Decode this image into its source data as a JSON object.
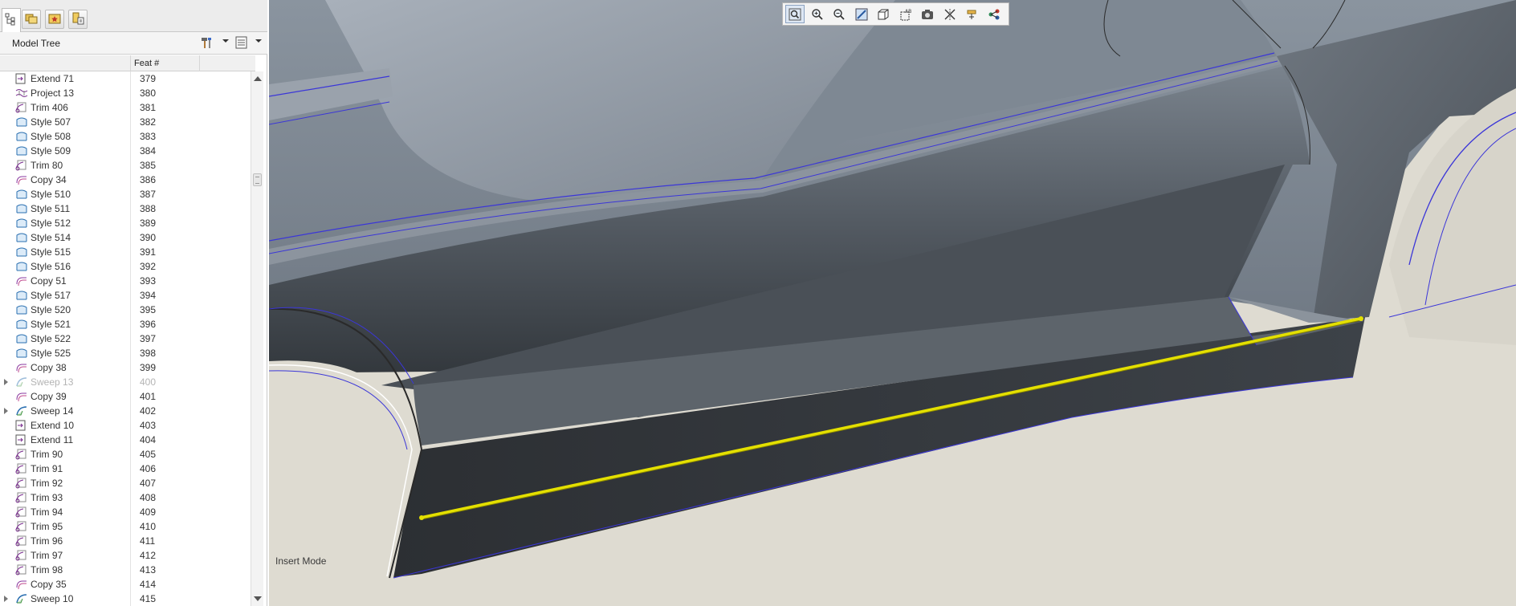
{
  "model_tree": {
    "title": "Model Tree",
    "column_feat": "Feat #",
    "rows": [
      {
        "name": "Extend 71",
        "num": "379",
        "icon": "extend-icon"
      },
      {
        "name": "Project 13",
        "num": "380",
        "icon": "project-icon"
      },
      {
        "name": "Trim 406",
        "num": "381",
        "icon": "trim-icon"
      },
      {
        "name": "Style 507",
        "num": "382",
        "icon": "style-icon"
      },
      {
        "name": "Style 508",
        "num": "383",
        "icon": "style-icon"
      },
      {
        "name": "Style 509",
        "num": "384",
        "icon": "style-icon"
      },
      {
        "name": "Trim 80",
        "num": "385",
        "icon": "trim-icon"
      },
      {
        "name": "Copy 34",
        "num": "386",
        "icon": "copy-icon"
      },
      {
        "name": "Style 510",
        "num": "387",
        "icon": "style-icon"
      },
      {
        "name": "Style 511",
        "num": "388",
        "icon": "style-icon"
      },
      {
        "name": "Style 512",
        "num": "389",
        "icon": "style-icon"
      },
      {
        "name": "Style 514",
        "num": "390",
        "icon": "style-icon"
      },
      {
        "name": "Style 515",
        "num": "391",
        "icon": "style-icon"
      },
      {
        "name": "Style 516",
        "num": "392",
        "icon": "style-icon"
      },
      {
        "name": "Copy 51",
        "num": "393",
        "icon": "copy-icon"
      },
      {
        "name": "Style 517",
        "num": "394",
        "icon": "style-icon"
      },
      {
        "name": "Style 520",
        "num": "395",
        "icon": "style-icon"
      },
      {
        "name": "Style 521",
        "num": "396",
        "icon": "style-icon"
      },
      {
        "name": "Style 522",
        "num": "397",
        "icon": "style-icon"
      },
      {
        "name": "Style 525",
        "num": "398",
        "icon": "style-icon"
      },
      {
        "name": "Copy 38",
        "num": "399",
        "icon": "copy-icon"
      },
      {
        "name": "Sweep 13",
        "num": "400",
        "icon": "sweep-icon",
        "expandable": true,
        "dim": true
      },
      {
        "name": "Copy 39",
        "num": "401",
        "icon": "copy-icon"
      },
      {
        "name": "Sweep 14",
        "num": "402",
        "icon": "sweep-icon",
        "expandable": true
      },
      {
        "name": "Extend 10",
        "num": "403",
        "icon": "extend-icon"
      },
      {
        "name": "Extend 11",
        "num": "404",
        "icon": "extend-icon"
      },
      {
        "name": "Trim 90",
        "num": "405",
        "icon": "trim-icon"
      },
      {
        "name": "Trim 91",
        "num": "406",
        "icon": "trim-icon"
      },
      {
        "name": "Trim 92",
        "num": "407",
        "icon": "trim-icon"
      },
      {
        "name": "Trim 93",
        "num": "408",
        "icon": "trim-icon"
      },
      {
        "name": "Trim 94",
        "num": "409",
        "icon": "trim-icon"
      },
      {
        "name": "Trim 95",
        "num": "410",
        "icon": "trim-icon"
      },
      {
        "name": "Trim 96",
        "num": "411",
        "icon": "trim-icon"
      },
      {
        "name": "Trim 97",
        "num": "412",
        "icon": "trim-icon"
      },
      {
        "name": "Trim 98",
        "num": "413",
        "icon": "trim-icon"
      },
      {
        "name": "Copy 35",
        "num": "414",
        "icon": "copy-icon"
      },
      {
        "name": "Sweep 10",
        "num": "415",
        "icon": "sweep-icon",
        "expandable": true
      }
    ]
  },
  "nav_tabs": [
    "model-tree-tab-icon",
    "folder-browser-tab-icon",
    "favorites-tab-icon",
    "layers-tab-icon"
  ],
  "view_toolbar": {
    "buttons": [
      "refit-icon",
      "zoom-in-icon",
      "zoom-out-icon",
      "repaint-icon",
      "saved-orientations-icon",
      "display-style-icon",
      "named-views-icon",
      "datum-display-icon",
      "spin-center-icon",
      "annotation-display-icon"
    ]
  },
  "status": {
    "mode": "Insert Mode"
  },
  "colors": {
    "selected_edge": "#e4e000",
    "edge_blue": "#3b36d8",
    "background": "#dcdad2"
  }
}
